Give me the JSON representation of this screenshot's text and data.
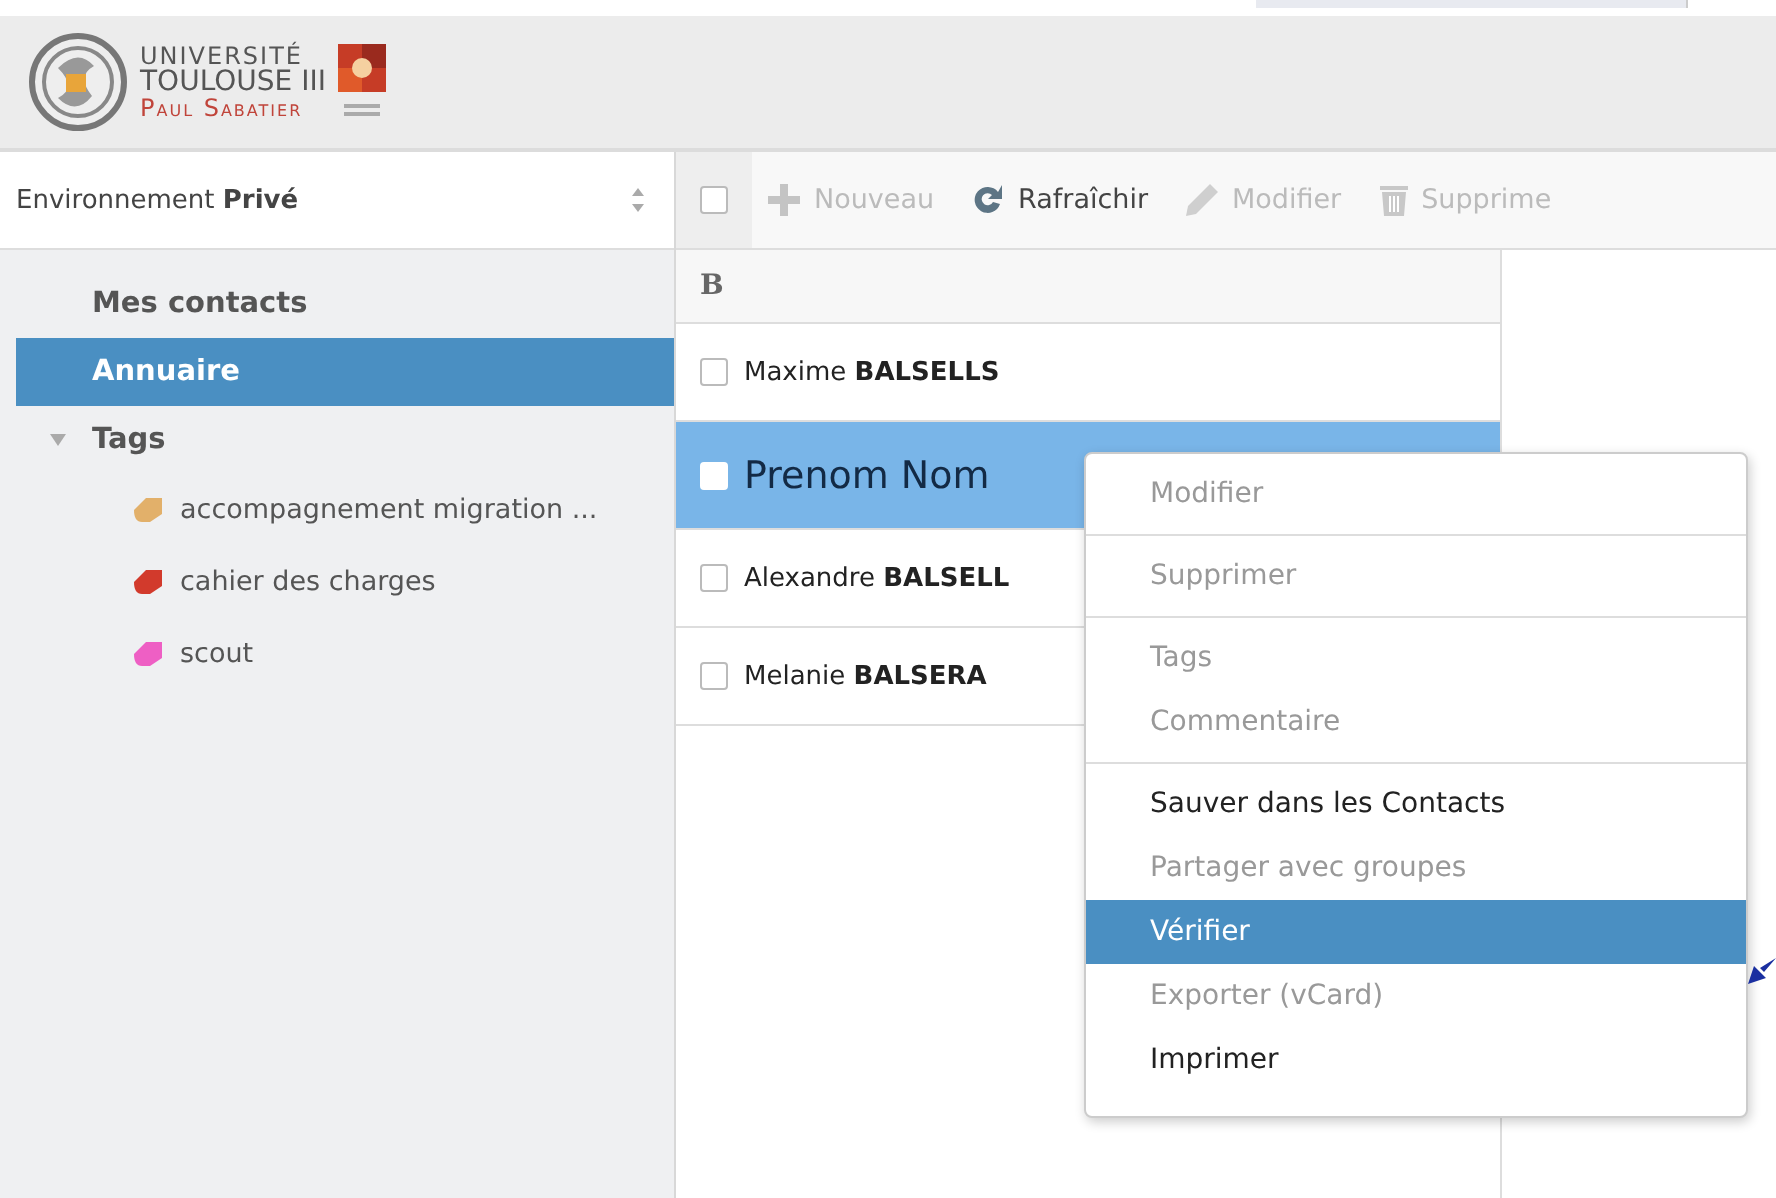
{
  "logo": {
    "lines": [
      "UNIVERSITÉ",
      "TOULOUSE III",
      "Paul Sabatier"
    ]
  },
  "environment": {
    "label": "Environnement",
    "value": "Privé"
  },
  "toolbar": [
    {
      "kind": "checkbox",
      "checked": false
    },
    {
      "kind": "plus",
      "label": "Nouveau",
      "disabled": true
    },
    {
      "kind": "refresh",
      "label": "Rafraîchir",
      "disabled": false
    },
    {
      "kind": "pencil",
      "label": "Modifier",
      "disabled": true
    },
    {
      "kind": "trash",
      "label": "Supprime",
      "disabled": true
    }
  ],
  "sidebar": {
    "items": [
      {
        "label": "Mes contacts",
        "selected": false
      },
      {
        "label": "Annuaire",
        "selected": true
      },
      {
        "label": "Tags",
        "selected": false,
        "expanded": true,
        "children": [
          {
            "label": "accompagnement migration ...",
            "color": "#e2b06a"
          },
          {
            "label": "cahier des charges",
            "color": "#d23a2c"
          },
          {
            "label": "scout",
            "color": "#ee5fc4"
          }
        ]
      }
    ]
  },
  "contacts": {
    "group": "B",
    "rows": [
      {
        "name": "Maxime **BALSELLS**",
        "selected": false,
        "checked": false
      },
      {
        "name": "Prenom Nom",
        "selected": true,
        "checked": false
      },
      {
        "name": "Alexandre **BALSELL**",
        "selected": false,
        "checked": false
      },
      {
        "name": "Melanie **BALSERA**",
        "selected": false,
        "checked": false
      }
    ]
  },
  "context_menu": {
    "groups": [
      [
        {
          "label": "Modifier",
          "disabled": true,
          "selected": false
        }
      ],
      [
        {
          "label": "Supprimer",
          "disabled": true,
          "selected": false
        }
      ],
      [
        {
          "label": "Tags",
          "disabled": true,
          "selected": false
        },
        {
          "label": "Commentaire",
          "disabled": true,
          "selected": false
        }
      ],
      [
        {
          "label": "Sauver dans les Contacts",
          "disabled": false,
          "selected": false
        },
        {
          "label": "Partager avec groupes",
          "disabled": true,
          "selected": false
        },
        {
          "label": "Vérifier",
          "disabled": false,
          "selected": true
        },
        {
          "label": "Exporter (vCard)",
          "disabled": true,
          "selected": false
        },
        {
          "label": "Imprimer",
          "disabled": false,
          "selected": false
        }
      ]
    ]
  }
}
